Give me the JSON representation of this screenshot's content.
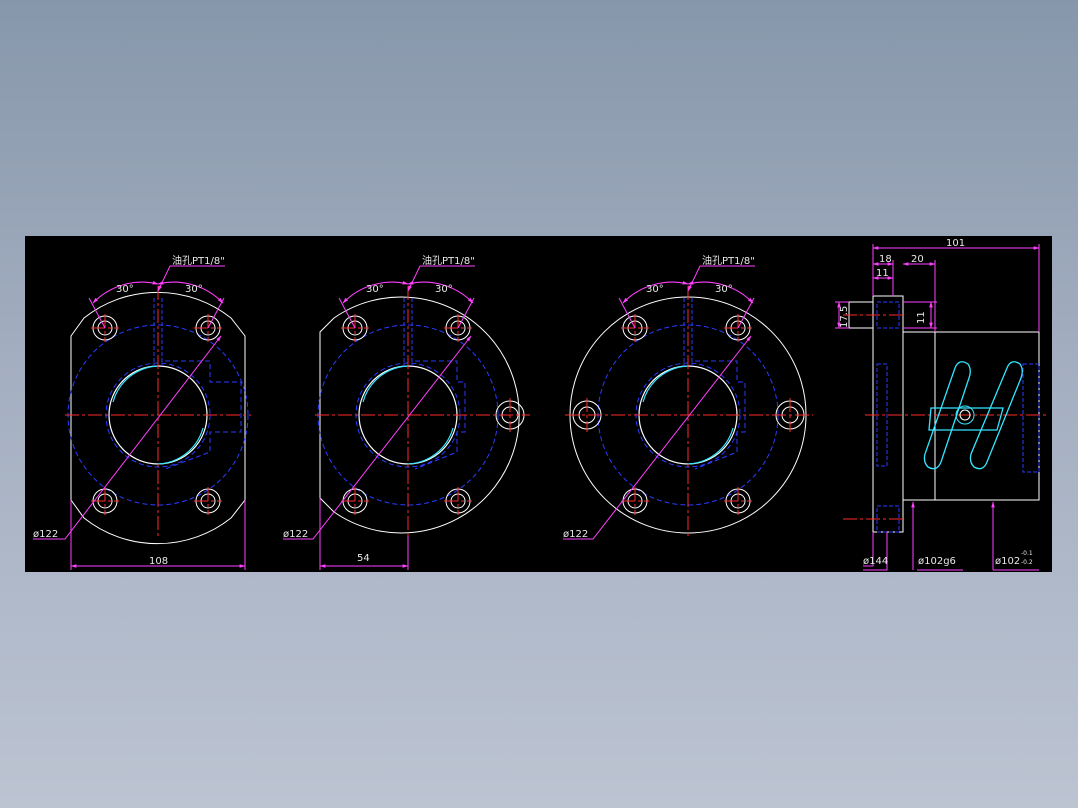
{
  "drawing": {
    "background": "#000000",
    "colors": {
      "outline": "#ffffff",
      "hidden": "#2a3cff",
      "center": "#ff2a2a",
      "dimension": "#ff40ff",
      "text": "#ffffff",
      "cyan": "#33e6ff"
    },
    "views": [
      {
        "oil_hole_label": "油孔PT1/8\"",
        "angle_left": "30°",
        "angle_right": "30°",
        "pcd_label": "ø122",
        "bottom_dim": "108"
      },
      {
        "oil_hole_label": "油孔PT1/8\"",
        "angle_left": "30°",
        "angle_right": "30°",
        "pcd_label": "ø122",
        "bottom_dim": "54"
      },
      {
        "oil_hole_label": "油孔PT1/8\"",
        "angle_left": "30°",
        "angle_right": "30°",
        "pcd_label": "ø122"
      }
    ],
    "side_view": {
      "dim_total": "101",
      "dim_18": "18",
      "dim_20": "20",
      "dim_11_top": "11",
      "dim_11_right": "11",
      "dim_17_5": "17.5",
      "dia_flange": "ø144",
      "dia_pilot": "ø102g6",
      "dia_body": "ø102",
      "dia_body_tol_upper": "-0.1",
      "dia_body_tol_lower": "-0.2"
    }
  }
}
